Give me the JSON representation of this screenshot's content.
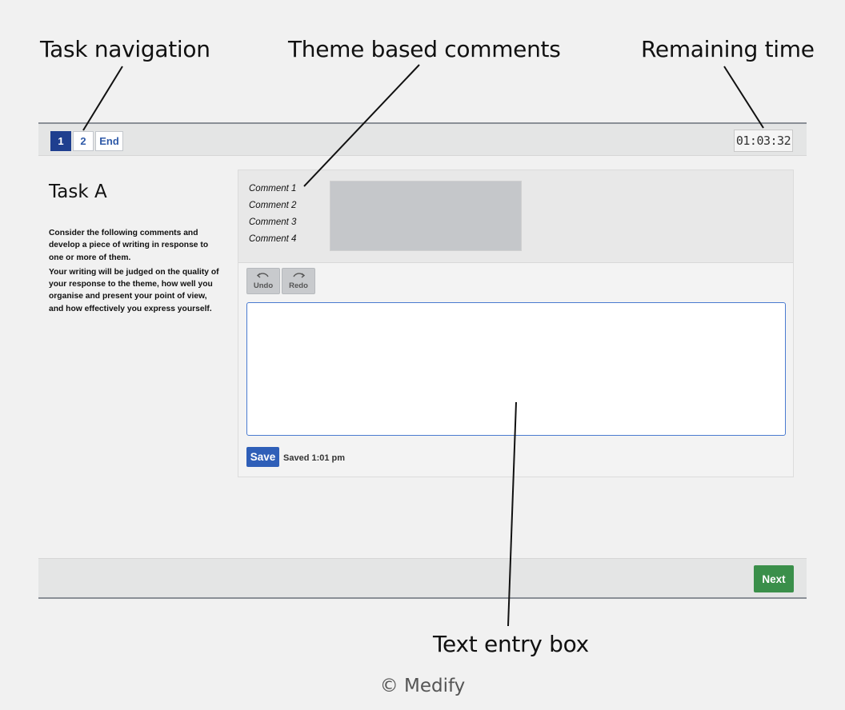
{
  "callouts": {
    "task_navigation": "Task navigation",
    "theme_comments": "Theme based comments",
    "remaining_time": "Remaining time",
    "text_entry": "Text entry box"
  },
  "nav": {
    "buttons": [
      {
        "label": "1",
        "active": true
      },
      {
        "label": "2",
        "active": false
      },
      {
        "label": "End",
        "active": false
      }
    ]
  },
  "timer": {
    "value": "01:03:32"
  },
  "task": {
    "title": "Task A",
    "instructions": [
      "Consider the following comments and develop a piece of writing in response to one or more of them.",
      "Your writing will be judged on the quality of your response to the theme, how well you organise and present your point of view, and how effectively you express yourself."
    ]
  },
  "comments": [
    "Comment 1",
    "Comment 2",
    "Comment 3",
    "Comment 4"
  ],
  "toolbar": {
    "undo_label": "Undo",
    "redo_label": "Redo"
  },
  "editor": {
    "value": ""
  },
  "save": {
    "label": "Save",
    "status": "Saved 1:01 pm"
  },
  "footer": {
    "next_label": "Next"
  },
  "copyright": "© Medify",
  "colors": {
    "accent": "#2f5fb8",
    "nav_active": "#1f3f8f",
    "next": "#3a8f4a"
  }
}
